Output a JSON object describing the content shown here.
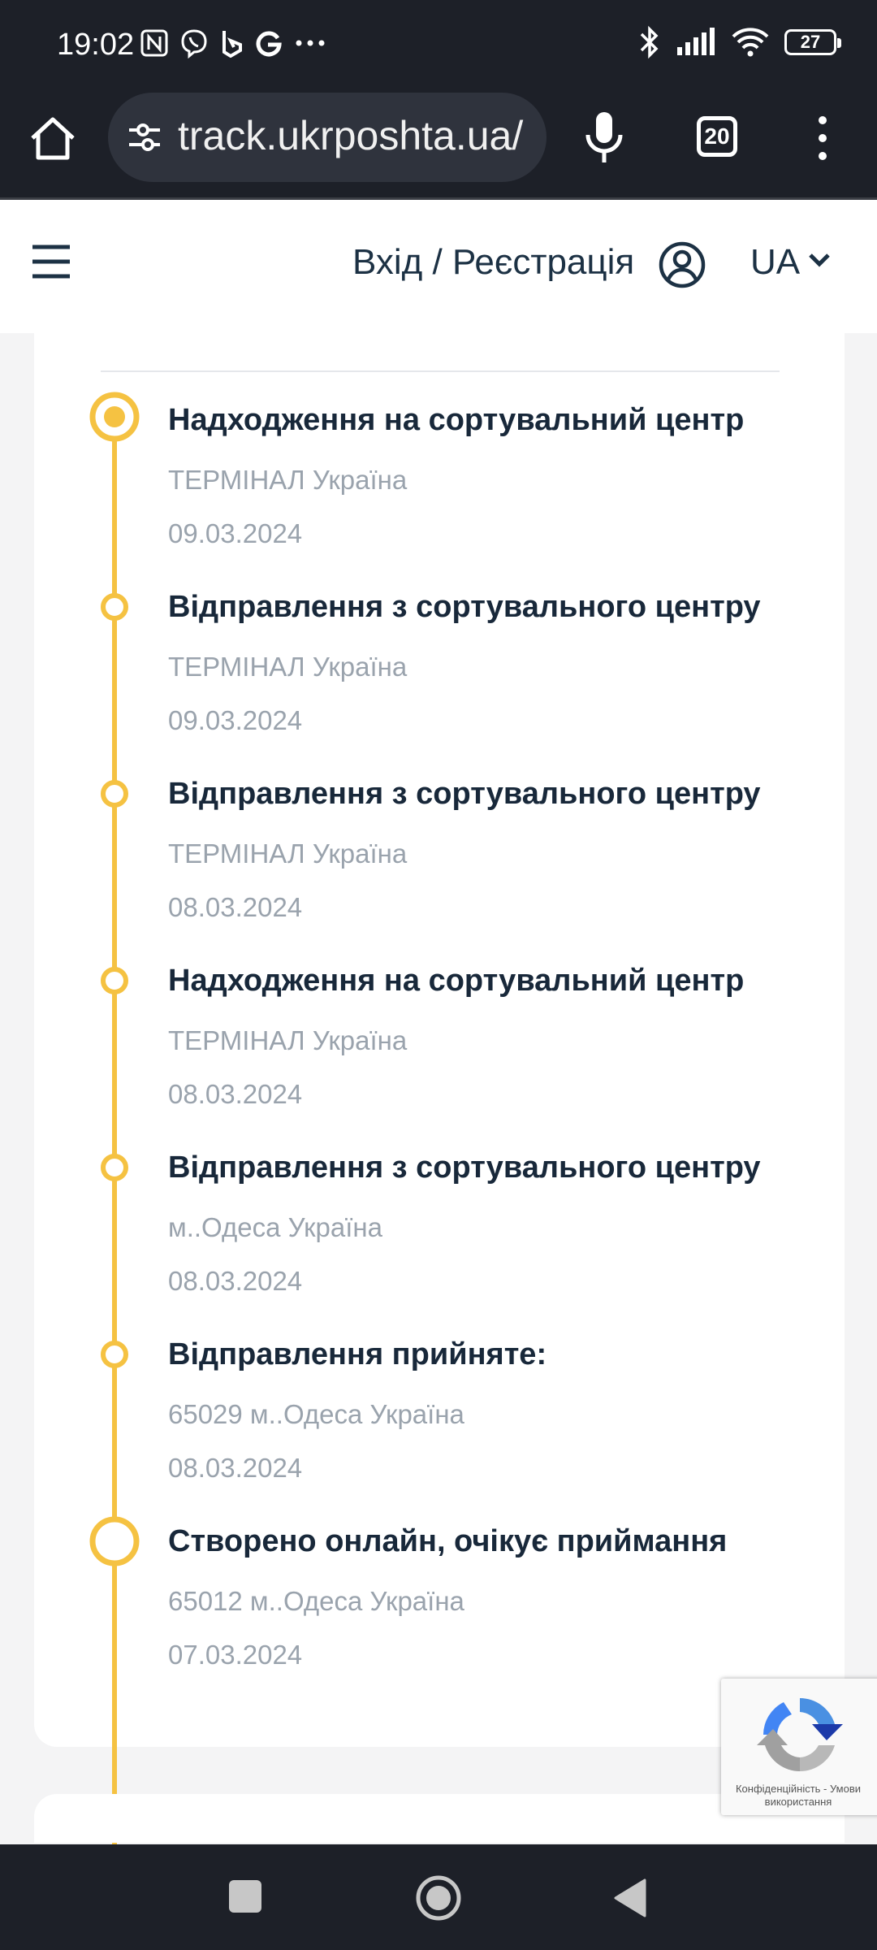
{
  "status_bar": {
    "time": "19:02",
    "battery": "27",
    "left_icons": [
      "nfc-icon",
      "viber-icon",
      "bing-icon",
      "google-icon",
      "more-notifications-icon"
    ],
    "right_icons": [
      "bluetooth-icon",
      "signal-icon",
      "wifi-icon",
      "battery-icon"
    ]
  },
  "browser": {
    "url": "track.ukrposhta.ua/",
    "tab_count": "20"
  },
  "header": {
    "login_label": "Вхід / Реєстрація",
    "language": "UA",
    "colors": {
      "text": "#1c3144",
      "accent": "#f5c242"
    }
  },
  "timeline": [
    {
      "title": "Надходження на сортувальний центр",
      "location": "ТЕРМІНАЛ Україна",
      "date": "09.03.2024",
      "state": "current"
    },
    {
      "title": "Відправлення з сортувального центру",
      "location": "ТЕРМІНАЛ Україна",
      "date": "09.03.2024",
      "state": "past"
    },
    {
      "title": "Відправлення з сортувального центру",
      "location": "ТЕРМІНАЛ Україна",
      "date": "08.03.2024",
      "state": "past"
    },
    {
      "title": "Надходження на сортувальний центр",
      "location": "ТЕРМІНАЛ Україна",
      "date": "08.03.2024",
      "state": "past"
    },
    {
      "title": "Відправлення з сортувального центру",
      "location": "м..Одеса Україна",
      "date": "08.03.2024",
      "state": "past"
    },
    {
      "title": "Відправлення прийняте:",
      "location": "65029 м..Одеса Україна",
      "date": "08.03.2024",
      "state": "past"
    },
    {
      "title": "Створено онлайн, очікує приймання",
      "location": "65012 м..Одеса Україна",
      "date": "07.03.2024",
      "state": "origin"
    }
  ],
  "recaptcha": {
    "links": "Конфіденційність - Умови використання"
  }
}
